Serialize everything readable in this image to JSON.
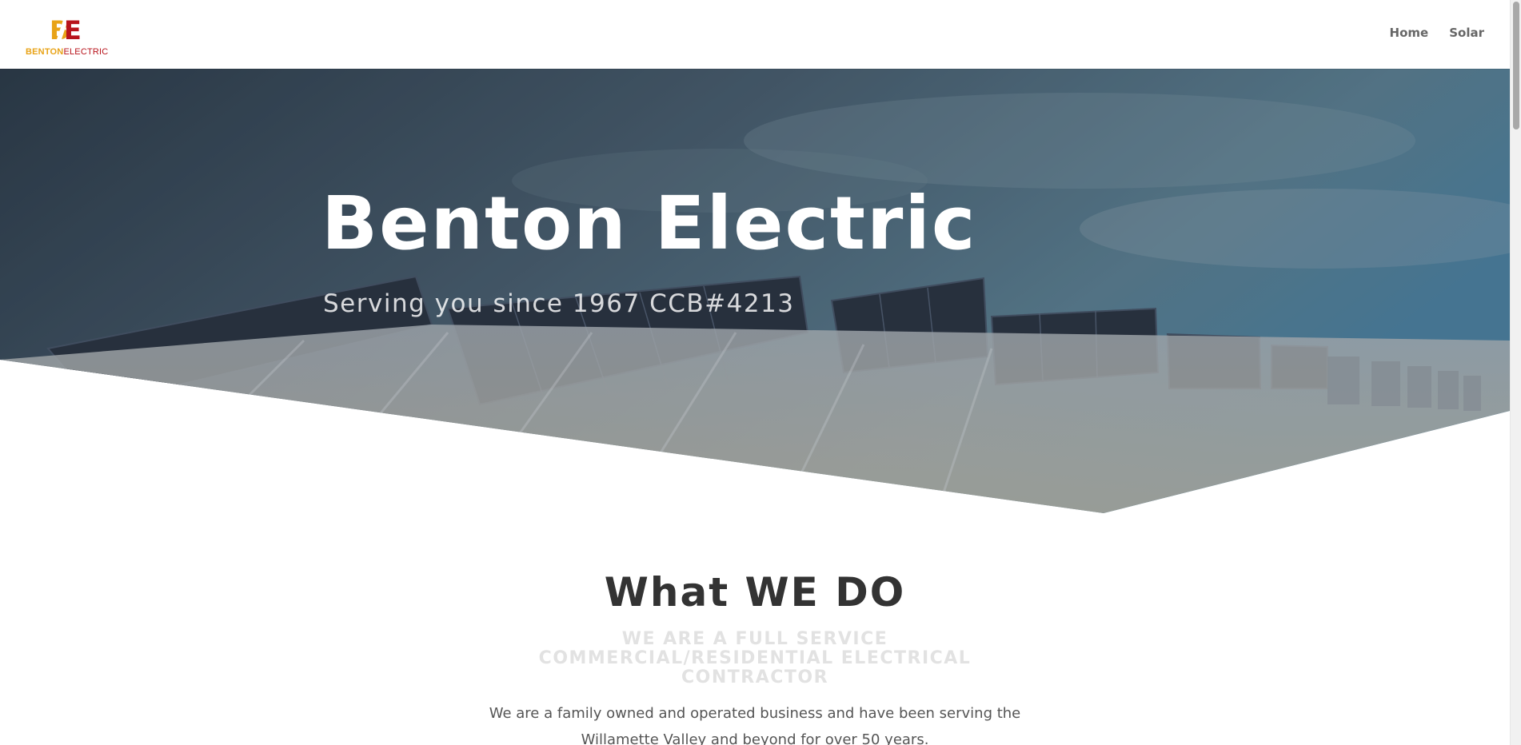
{
  "header": {
    "logo": {
      "part1": "BENTON",
      "part2": "ELECTRIC",
      "mark": "B/E"
    },
    "nav": [
      {
        "label": "Home"
      },
      {
        "label": "Solar"
      }
    ]
  },
  "hero": {
    "title": "Benton Electric",
    "subtitle": "Serving you since 1967 CCB#4213"
  },
  "what": {
    "title": "What WE DO",
    "subtitle": "WE ARE A FULL SERVICE COMMERCIAL/RESIDENTIAL ELECTRICAL CONTRACTOR",
    "body": "We are a family owned and operated business and have been serving the Willamette Valley and beyond for over 50 years."
  },
  "colors": {
    "brand_yellow": "#e8a317",
    "brand_red": "#b8131b",
    "nav_text": "#666666",
    "heading": "#333333"
  }
}
